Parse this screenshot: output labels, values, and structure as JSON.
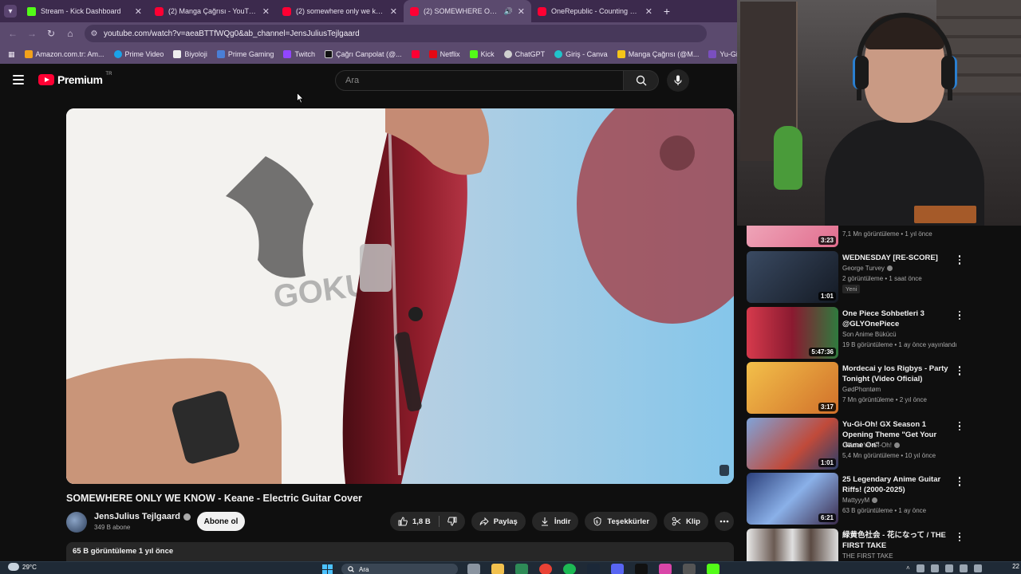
{
  "browser": {
    "tabs": [
      {
        "title": "Stream - Kick Dashboard",
        "favicon": "kick",
        "active": false
      },
      {
        "title": "(2) Manga Çağrısı - YouTube",
        "favicon": "youtube",
        "active": false
      },
      {
        "title": "(2) somewhere only we know c",
        "favicon": "youtube",
        "active": false
      },
      {
        "title": "(2) SOMEWHERE ONLY WE",
        "favicon": "youtube",
        "active": true,
        "audio": true
      },
      {
        "title": "OneRepublic - Counting Stars -",
        "favicon": "youtube",
        "active": false
      }
    ],
    "url": "youtube.com/watch?v=aeaBTTfWQg0&ab_channel=JensJuliusTejlgaard",
    "bookmarks": [
      {
        "label": "Amazon.com.tr: Am...",
        "color": "#f3a21b"
      },
      {
        "label": "Prime Video",
        "color": "#1aa3e8"
      },
      {
        "label": "Biyoloji",
        "color": "#ffffff"
      },
      {
        "label": "Prime Gaming",
        "color": "#4a7fd6"
      },
      {
        "label": "Twitch",
        "color": "#9146ff"
      },
      {
        "label": "Çağrı Canpolat (@...",
        "color": "#000000"
      },
      {
        "label": "",
        "color": "#ff0033"
      },
      {
        "label": "Netflix",
        "color": "#e50914"
      },
      {
        "label": "Kick",
        "color": "#53fc18"
      },
      {
        "label": "ChatGPT",
        "color": "#d0d0d0"
      },
      {
        "label": "Giriş - Canva",
        "color": "#20c4cb"
      },
      {
        "label": "Manga Çağrısı (@M...",
        "color": "#f5c518"
      },
      {
        "label": "Yu-Gi-Oh! Master...",
        "color": "#7a4fbf"
      }
    ]
  },
  "header": {
    "logo_text": "Premium",
    "region": "TR",
    "search_placeholder": "Ara"
  },
  "video": {
    "title": "SOMEWHERE ONLY WE KNOW - Keane - Electric Guitar Cover",
    "channel": "JensJulius Tejlgaard",
    "subscribers": "349 B abone",
    "subscribe_label": "Abone ol",
    "likes": "1,8 B",
    "share_label": "Paylaş",
    "download_label": "İndir",
    "thanks_label": "Teşekkürler",
    "clip_label": "Klip",
    "stats": "65 B görüntüleme  1 yıl önce"
  },
  "recommendations": [
    {
      "title": "",
      "channel": "",
      "meta": "7,1 Mn görüntüleme • 1 yıl önce",
      "duration": "3:23",
      "thumb": "#e88aa6"
    },
    {
      "title": "WEDNESDAY [RE-SCORE]",
      "channel": "George Turvey",
      "verified": true,
      "meta": "2 görüntüleme • 1 saat önce",
      "badge": "Yeni",
      "duration": "1:01",
      "thumb": "#2a3448"
    },
    {
      "title": "One Piece Sohbetleri 3 @GLYOnePiece",
      "channel": "Son Anime Bükücü",
      "meta": "19 B görüntüleme • 1 ay önce yayınlandı",
      "duration": "5:47:36",
      "thumb": "#c0233a"
    },
    {
      "title": "Mordecai y los Rigbys - Party Tonight (Video Oficial)",
      "channel": "GødPhαntøm",
      "meta": "7 Mn görüntüleme • 2 yıl önce",
      "duration": "3:17",
      "thumb": "#e8a23a"
    },
    {
      "title": "Yu-Gi-Oh! GX Season 1 Opening Theme \"Get Your Game On\"",
      "channel": "Official Yu-Gi-Oh!",
      "verified": true,
      "meta": "5,4 Mn görüntüleme • 10 yıl önce",
      "duration": "1:01",
      "thumb": "#5a7fbf"
    },
    {
      "title": "25 Legendary Anime Guitar Riffs! (2000-2025)",
      "channel": "MattyyyM",
      "verified": true,
      "meta": "63 B görüntüleme • 1 ay önce",
      "duration": "6:21",
      "thumb": "#3f5a9a"
    },
    {
      "title": "緑黄色社会 - 花になって / THE FIRST TAKE",
      "channel": "THE FIRST TAKE",
      "meta": "",
      "duration": "",
      "thumb": "#d9d9d9"
    }
  ],
  "taskbar": {
    "temperature": "29°C",
    "search_placeholder": "Ara",
    "clock": "22"
  }
}
